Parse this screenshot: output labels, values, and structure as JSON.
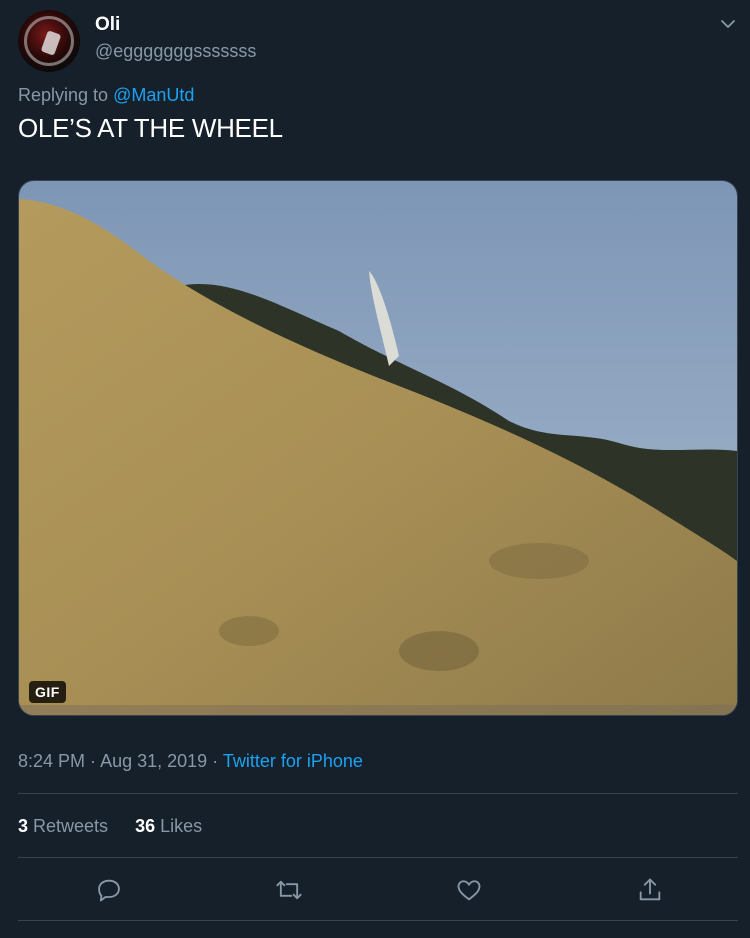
{
  "user": {
    "display_name": "Oli",
    "handle": "@egggggggsssssss"
  },
  "reply": {
    "prefix": "Replying to ",
    "mention": "@ManUtd"
  },
  "tweet": {
    "text": "OLE’S AT THE WHEEL"
  },
  "media": {
    "badge": "GIF"
  },
  "meta": {
    "time": "8:24 PM",
    "separator1": " · ",
    "date": "Aug 31, 2019",
    "separator2": " · ",
    "source": "Twitter for iPhone"
  },
  "stats": {
    "retweets_count": "3",
    "retweets_label": " Retweets",
    "likes_count": "36",
    "likes_label": " Likes"
  },
  "actions": {
    "icons": [
      "reply-icon",
      "retweet-icon",
      "like-icon",
      "share-icon"
    ]
  },
  "colors": {
    "background": "#15202b",
    "secondary_text": "#8899a6",
    "accent": "#1da1f2",
    "divider": "#38444d"
  }
}
